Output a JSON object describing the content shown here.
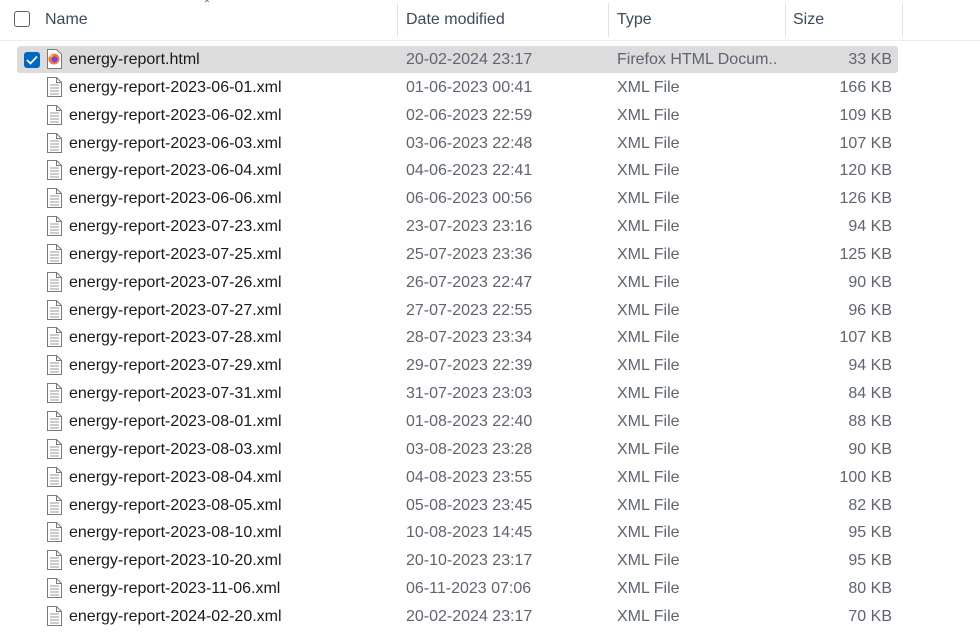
{
  "columns": {
    "name": "Name",
    "date": "Date modified",
    "type": "Type",
    "size": "Size"
  },
  "files": [
    {
      "name": "energy-report.html",
      "date": "20-02-2024 23:17",
      "type": "Firefox HTML Docum...",
      "size": "33 KB",
      "icon": "firefox-html-icon",
      "selected": true
    },
    {
      "name": "energy-report-2023-06-01.xml",
      "date": "01-06-2023 00:41",
      "type": "XML File",
      "size": "166 KB",
      "icon": "document-icon"
    },
    {
      "name": "energy-report-2023-06-02.xml",
      "date": "02-06-2023 22:59",
      "type": "XML File",
      "size": "109 KB",
      "icon": "document-icon"
    },
    {
      "name": "energy-report-2023-06-03.xml",
      "date": "03-06-2023 22:48",
      "type": "XML File",
      "size": "107 KB",
      "icon": "document-icon"
    },
    {
      "name": "energy-report-2023-06-04.xml",
      "date": "04-06-2023 22:41",
      "type": "XML File",
      "size": "120 KB",
      "icon": "document-icon"
    },
    {
      "name": "energy-report-2023-06-06.xml",
      "date": "06-06-2023 00:56",
      "type": "XML File",
      "size": "126 KB",
      "icon": "document-icon"
    },
    {
      "name": "energy-report-2023-07-23.xml",
      "date": "23-07-2023 23:16",
      "type": "XML File",
      "size": "94 KB",
      "icon": "document-icon"
    },
    {
      "name": "energy-report-2023-07-25.xml",
      "date": "25-07-2023 23:36",
      "type": "XML File",
      "size": "125 KB",
      "icon": "document-icon"
    },
    {
      "name": "energy-report-2023-07-26.xml",
      "date": "26-07-2023 22:47",
      "type": "XML File",
      "size": "90 KB",
      "icon": "document-icon"
    },
    {
      "name": "energy-report-2023-07-27.xml",
      "date": "27-07-2023 22:55",
      "type": "XML File",
      "size": "96 KB",
      "icon": "document-icon"
    },
    {
      "name": "energy-report-2023-07-28.xml",
      "date": "28-07-2023 23:34",
      "type": "XML File",
      "size": "107 KB",
      "icon": "document-icon"
    },
    {
      "name": "energy-report-2023-07-29.xml",
      "date": "29-07-2023 22:39",
      "type": "XML File",
      "size": "94 KB",
      "icon": "document-icon"
    },
    {
      "name": "energy-report-2023-07-31.xml",
      "date": "31-07-2023 23:03",
      "type": "XML File",
      "size": "84 KB",
      "icon": "document-icon"
    },
    {
      "name": "energy-report-2023-08-01.xml",
      "date": "01-08-2023 22:40",
      "type": "XML File",
      "size": "88 KB",
      "icon": "document-icon"
    },
    {
      "name": "energy-report-2023-08-03.xml",
      "date": "03-08-2023 23:28",
      "type": "XML File",
      "size": "90 KB",
      "icon": "document-icon"
    },
    {
      "name": "energy-report-2023-08-04.xml",
      "date": "04-08-2023 23:55",
      "type": "XML File",
      "size": "100 KB",
      "icon": "document-icon"
    },
    {
      "name": "energy-report-2023-08-05.xml",
      "date": "05-08-2023 23:45",
      "type": "XML File",
      "size": "82 KB",
      "icon": "document-icon"
    },
    {
      "name": "energy-report-2023-08-10.xml",
      "date": "10-08-2023 14:45",
      "type": "XML File",
      "size": "95 KB",
      "icon": "document-icon"
    },
    {
      "name": "energy-report-2023-10-20.xml",
      "date": "20-10-2023 23:17",
      "type": "XML File",
      "size": "95 KB",
      "icon": "document-icon"
    },
    {
      "name": "energy-report-2023-11-06.xml",
      "date": "06-11-2023 07:06",
      "type": "XML File",
      "size": "80 KB",
      "icon": "document-icon"
    },
    {
      "name": "energy-report-2024-02-20.xml",
      "date": "20-02-2024 23:17",
      "type": "XML File",
      "size": "70 KB",
      "icon": "document-icon"
    }
  ],
  "colors": {
    "selection_bg": "#dcdcdc",
    "checkbox_accent": "#0067c0",
    "header_text": "#3c4a5c",
    "secondary_text": "#5e6470"
  }
}
